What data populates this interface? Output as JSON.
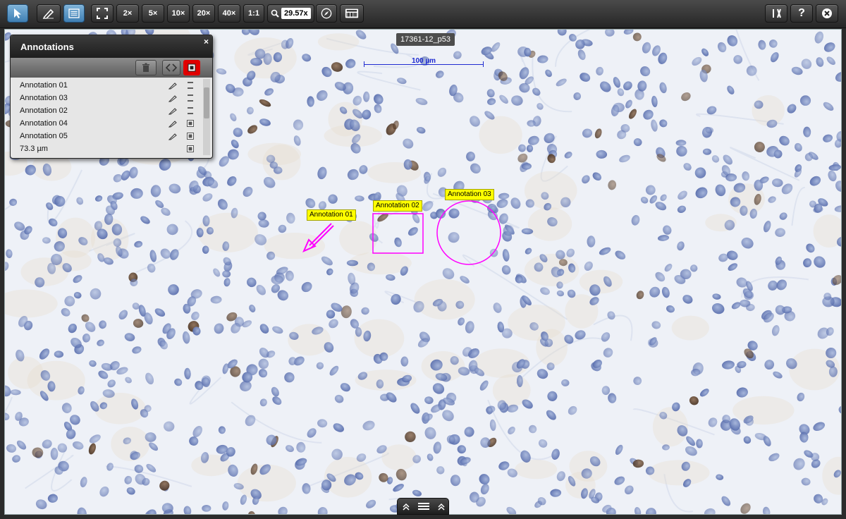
{
  "toolbar": {
    "zoom_buttons": [
      "2×",
      "5×",
      "10×",
      "20×",
      "40×",
      "1:1"
    ],
    "zoom_value": "29.57x",
    "tools": [
      "pointer-icon",
      "pen-icon",
      "annotation-list-icon",
      "fit-screen-icon",
      "search-icon",
      "compass-icon",
      "barcode-icon",
      "settings-icon",
      "help-icon",
      "close-icon"
    ],
    "help_label": "?"
  },
  "slide": {
    "name": "17361-12_p53",
    "scalebar_label": "100 µm"
  },
  "annotations_on_slide": [
    {
      "label": "Annotation 01",
      "shape": "arrow",
      "color": "#ff00ff"
    },
    {
      "label": "Annotation 02",
      "shape": "rectangle",
      "color": "#ff00ff"
    },
    {
      "label": "Annotation 03",
      "shape": "circle",
      "color": "#ff00ff"
    }
  ],
  "panel": {
    "title": "Annotations",
    "close_label": "×",
    "items": [
      {
        "label": "Annotation 01"
      },
      {
        "label": "Annotation 03"
      },
      {
        "label": "Annotation 02"
      },
      {
        "label": "Annotation 04"
      },
      {
        "label": "Annotation 05"
      },
      {
        "label": "73.3 µm"
      }
    ]
  },
  "colors": {
    "annotation": "#ff00ff",
    "label_bg": "#ffff00",
    "scalebar": "#1f2bd1",
    "highlight": "#e00000"
  }
}
